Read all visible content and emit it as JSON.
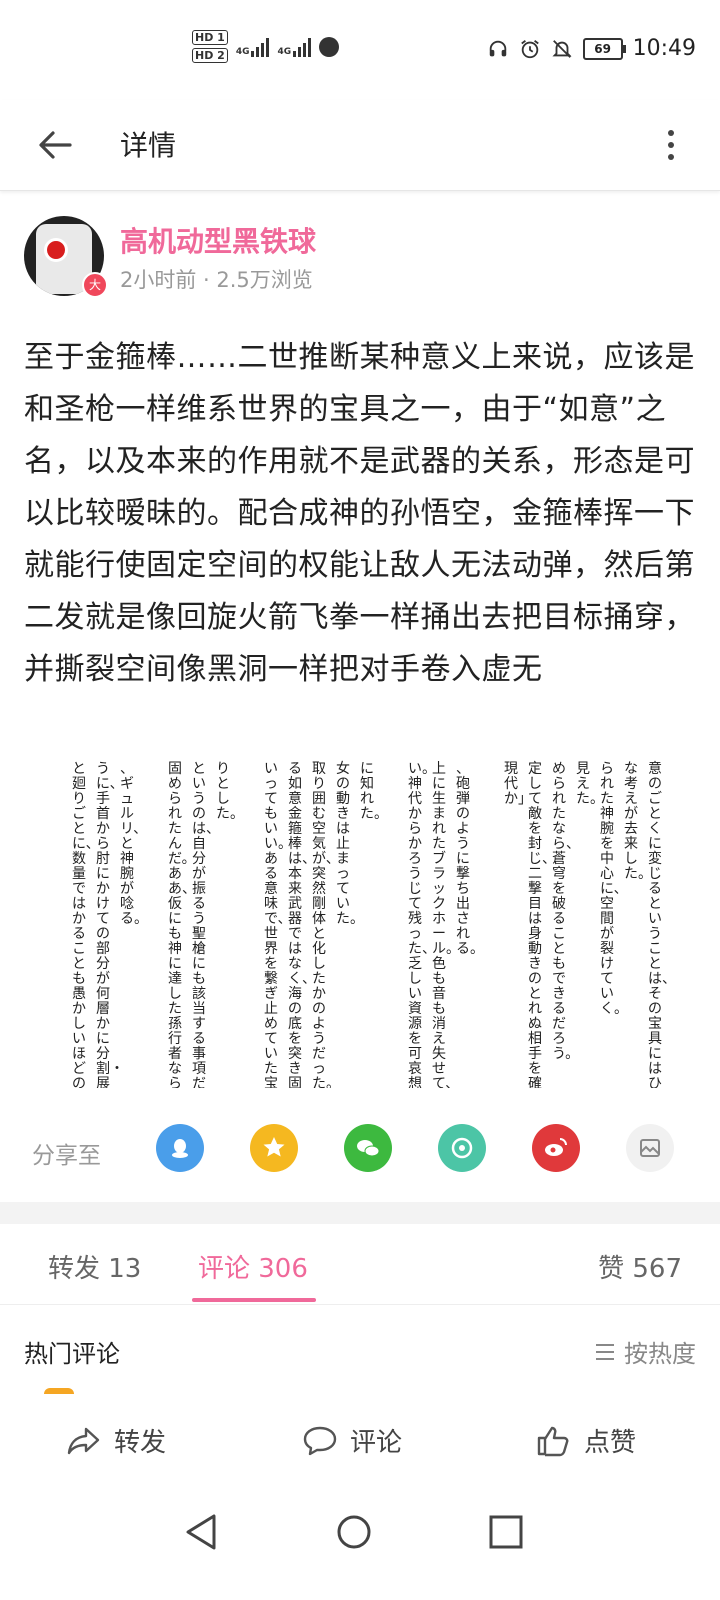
{
  "status_bar": {
    "hd1": "HD 1",
    "hd2": "HD 2",
    "net1": "4G",
    "net2": "4G",
    "battery": "69",
    "time": "10:49"
  },
  "header": {
    "title": "详情"
  },
  "post": {
    "author": "高机动型黑铁球",
    "avatar_badge": "大",
    "meta": "2小时前 · 2.5万浏览",
    "text": "至于金箍棒……二世推断某种意义上来说，应该是和圣枪一样维系世界的宝具之一，由于“如意”之名，以及本来的作用就不是武器的关系，形态是可以比较暧昧的。配合成神的孙悟空，金箍棒挥一下就能行使固定空间的权能让敌人无法动弹，然后第二发就是像回旋火箭飞拳一样捅出去把目标捅穿，并撕裂空间像黑洞一样把对手卷入虚无",
    "image_columns": [
      "意のごとくに変じるということは、その宝具にはひとつの",
      "な考えが去来した。",
      "られた神腕を中心に、空間が裂けていく。",
      "見えた。",
      "められたなら、蒼穹を破ることもできるだろう。",
      "定して敵を封じ、二撃目は身動きのとれぬ相手を確実に穿",
      "現代か」",
      "",
      "、砲弾のように撃ち出される。",
      "上に生まれたブラックホール。色も音も消え失せて、ただ",
      "い。神代からかろうじて残った、乏しい資源を可哀想な",
      "",
      "に知れた。",
      "女の動きは止まっていた。",
      "取り囲む空気が、突然剛体と化したかのようだった。",
      "る如意金箍棒は、本来武器ではなく、海の底を突き固め",
      "いってもいい。ある意味で、世界を繋ぎ止めていた宝具の",
      "",
      "りとした。",
      "というのは、自分が振るう聖槍にも該当する事項だったか",
      "固められたんだ。ああ、仮にも神に達した孫行者ならば、",
      "",
      "、ギュルリ、と神腕が唸る。",
      "うに、手首から肘にかけての部分が何層かに分割・展開し",
      "と廻りごとに、数量ではかることも愚かしいほどの魔力が"
    ]
  },
  "share": {
    "label": "分享至",
    "targets": [
      "qq-icon",
      "qzone-icon",
      "wechat-icon",
      "moments-icon",
      "weibo-icon",
      "gallery-icon"
    ],
    "colors": [
      "#4a9eea",
      "#f5b820",
      "#3db93f",
      "#4cc5a6",
      "#e0393b",
      "#f1f1f1"
    ]
  },
  "tabs": {
    "repost": "转发 13",
    "comments": "评论 306",
    "likes": "赞 567"
  },
  "comments_section": {
    "title": "热门评论",
    "sort": "按热度"
  },
  "actions": {
    "repost": "转发",
    "comment": "评论",
    "like": "点赞"
  },
  "colors": {
    "accent": "#f0699a",
    "text": "#222222",
    "muted": "#999999"
  }
}
